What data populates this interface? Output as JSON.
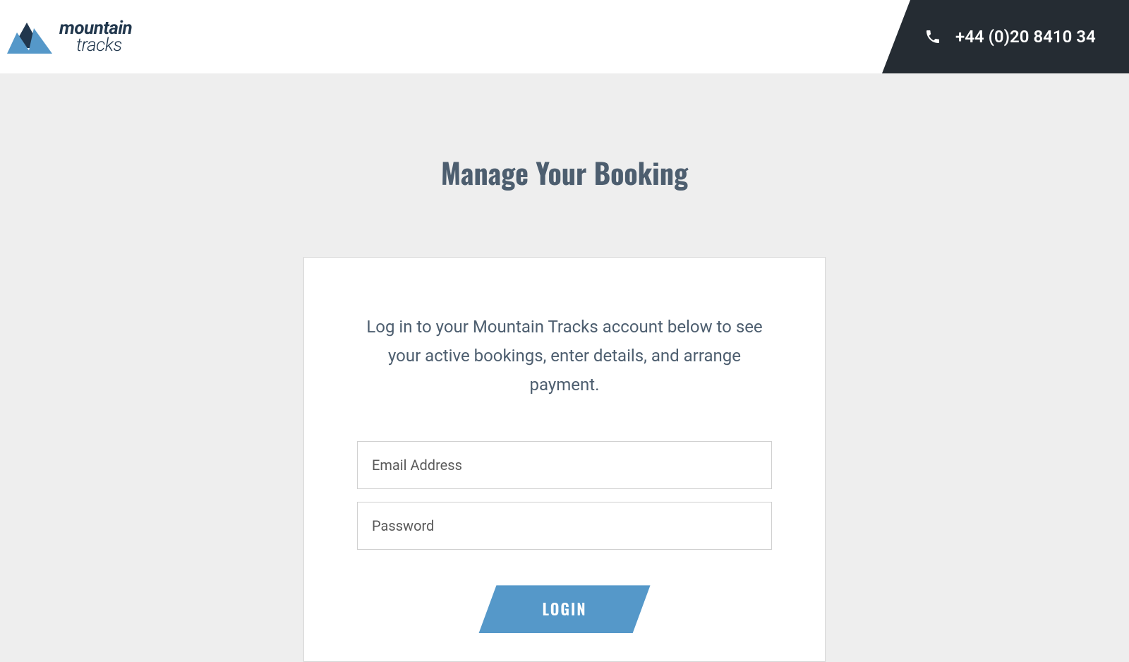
{
  "header": {
    "logo": {
      "text_top": "mountain",
      "text_bottom": "tracks"
    },
    "phone": "+44 (0)20 8410 34"
  },
  "main": {
    "title": "Manage Your Booking",
    "login": {
      "description": "Log in to your Mountain Tracks account below to see your active bookings, enter details, and arrange payment.",
      "email_placeholder": "Email Address",
      "password_placeholder": "Password",
      "button_label": "LOGIN"
    }
  }
}
